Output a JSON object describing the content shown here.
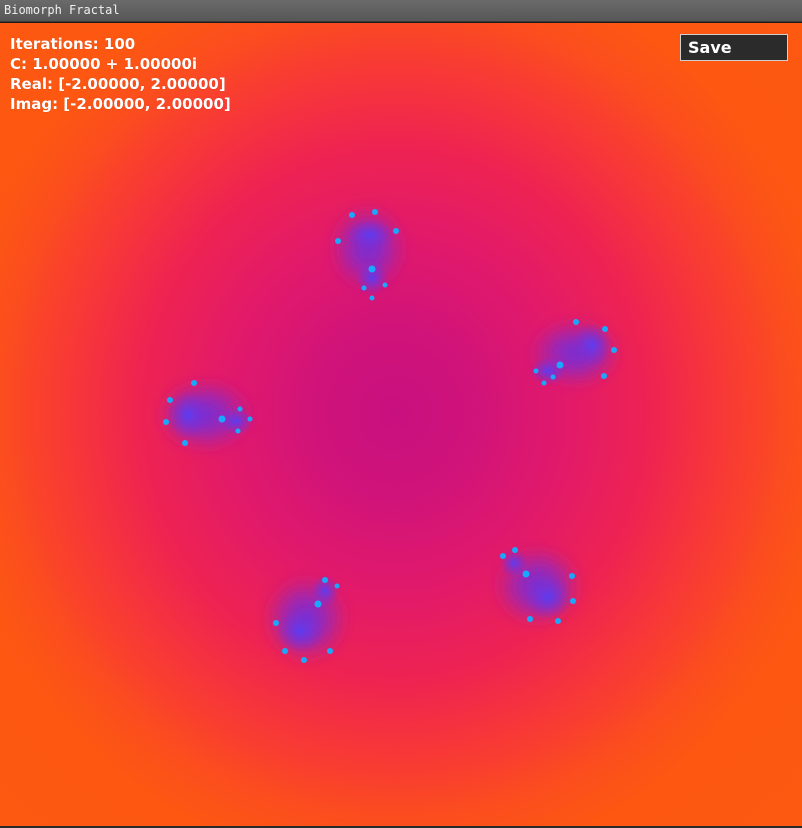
{
  "window": {
    "title": "Biomorph Fractal"
  },
  "info": {
    "iterations": "Iterations: 100",
    "c_value": "C: 1.00000 + 1.00000i",
    "real_range": "Real: [-2.00000, 2.00000]",
    "imag_range": "Imag: [-2.00000, 2.00000]"
  },
  "toolbar": {
    "save_label": "Save"
  },
  "colors": {
    "background_outer": "#fd5514",
    "background_center": "#c8107e",
    "biomorph_body": "#7a2fd6",
    "biomorph_highlight": "#1aa0ff",
    "text": "#ffffff",
    "button_bg": "#2b2b2b"
  }
}
